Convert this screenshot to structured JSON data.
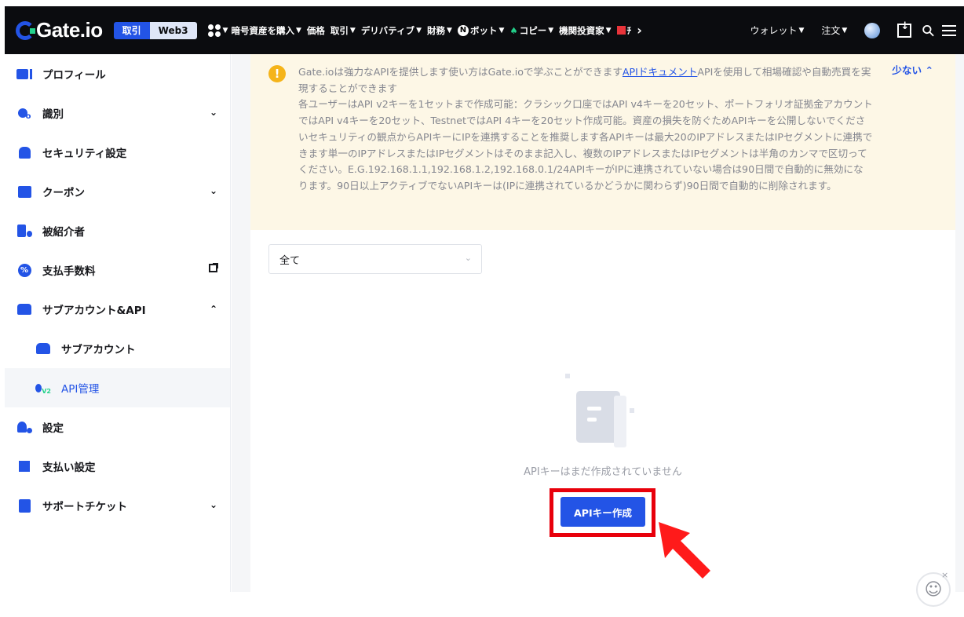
{
  "header": {
    "logo_text": "Gate.io",
    "mode_active": "取引",
    "mode_inactive": "Web3",
    "nav": [
      {
        "label": "暗号資産を購入"
      },
      {
        "label": "価格"
      },
      {
        "label": "取引"
      },
      {
        "label": "デリバティブ"
      },
      {
        "label": "財務"
      },
      {
        "label": "ボット",
        "icon": "N"
      },
      {
        "label": "コピー"
      },
      {
        "label": "機関投資家"
      },
      {
        "label": "ﾁ"
      }
    ],
    "more_glyph": "›",
    "wallet": "ウォレット",
    "orders": "注文"
  },
  "sidebar": {
    "items": [
      {
        "label": "プロフィール",
        "icon": "profile-card-icon"
      },
      {
        "label": "識別",
        "icon": "identity-icon"
      },
      {
        "label": "セキュリティ設定",
        "icon": "security-icon"
      },
      {
        "label": "クーポン",
        "icon": "coupon-icon"
      },
      {
        "label": "被紹介者",
        "icon": "referral-icon"
      },
      {
        "label": "支払手数料",
        "icon": "fee-percent-icon"
      },
      {
        "label": "サブアカウント&API",
        "icon": "subaccount-api-icon"
      },
      {
        "label": "サブアカウント",
        "icon": "subaccount-icon"
      },
      {
        "label": "API管理",
        "icon": "api-v2-icon"
      },
      {
        "label": "設定",
        "icon": "settings-user-icon"
      },
      {
        "label": "支払い設定",
        "icon": "payment-icon"
      },
      {
        "label": "サポートチケット",
        "icon": "ticket-icon"
      }
    ]
  },
  "notice": {
    "line1_pre": "Gate.ioは強力なAPIを提供します使い方はGate.ioで学ぶことができます",
    "line1_link": "APIドキュメント",
    "line1_post": "APIを使用して相場確認や自動売買を実現することができます",
    "line2": "各ユーザーはAPI v2キーを1セットまで作成可能：クラシック口座ではAPI v4キーを20セット、ポートフォリオ証拠金アカウントではAPI v4キーを20セット、TestnetではAPI 4キーを20セット作成可能。資産の損失を防ぐためAPIキーを公開しないでくださいセキュリティの観点からAPIキーにIPを連携することを推奨します各APIキーは最大20のIPアドレスまたはIPセグメントに連携できます単一のIPアドレスまたはIPセグメントはそのまま記入し、複数のIPアドレスまたはIPセグメントは半角のカンマで区切ってください。E.G.192.168.1.1,192.168.1.2,192.168.0.1/24APIキーがIPに連携されていない場合は90日間で自動的に無効になります。90日以上アクティブでないAPIキーは(IPに連携されているかどうかに関わらず)90日間で自動的に削除されます。",
    "collapse": "少ない"
  },
  "filter": {
    "selected": "全て"
  },
  "empty": {
    "message": "APIキーはまだ作成されていません",
    "create_button": "APIキー作成"
  },
  "colors": {
    "brand": "#2354e6",
    "highlight": "#e8000b",
    "notice_bg": "#fdf7e6",
    "warning": "#f5b41a"
  }
}
